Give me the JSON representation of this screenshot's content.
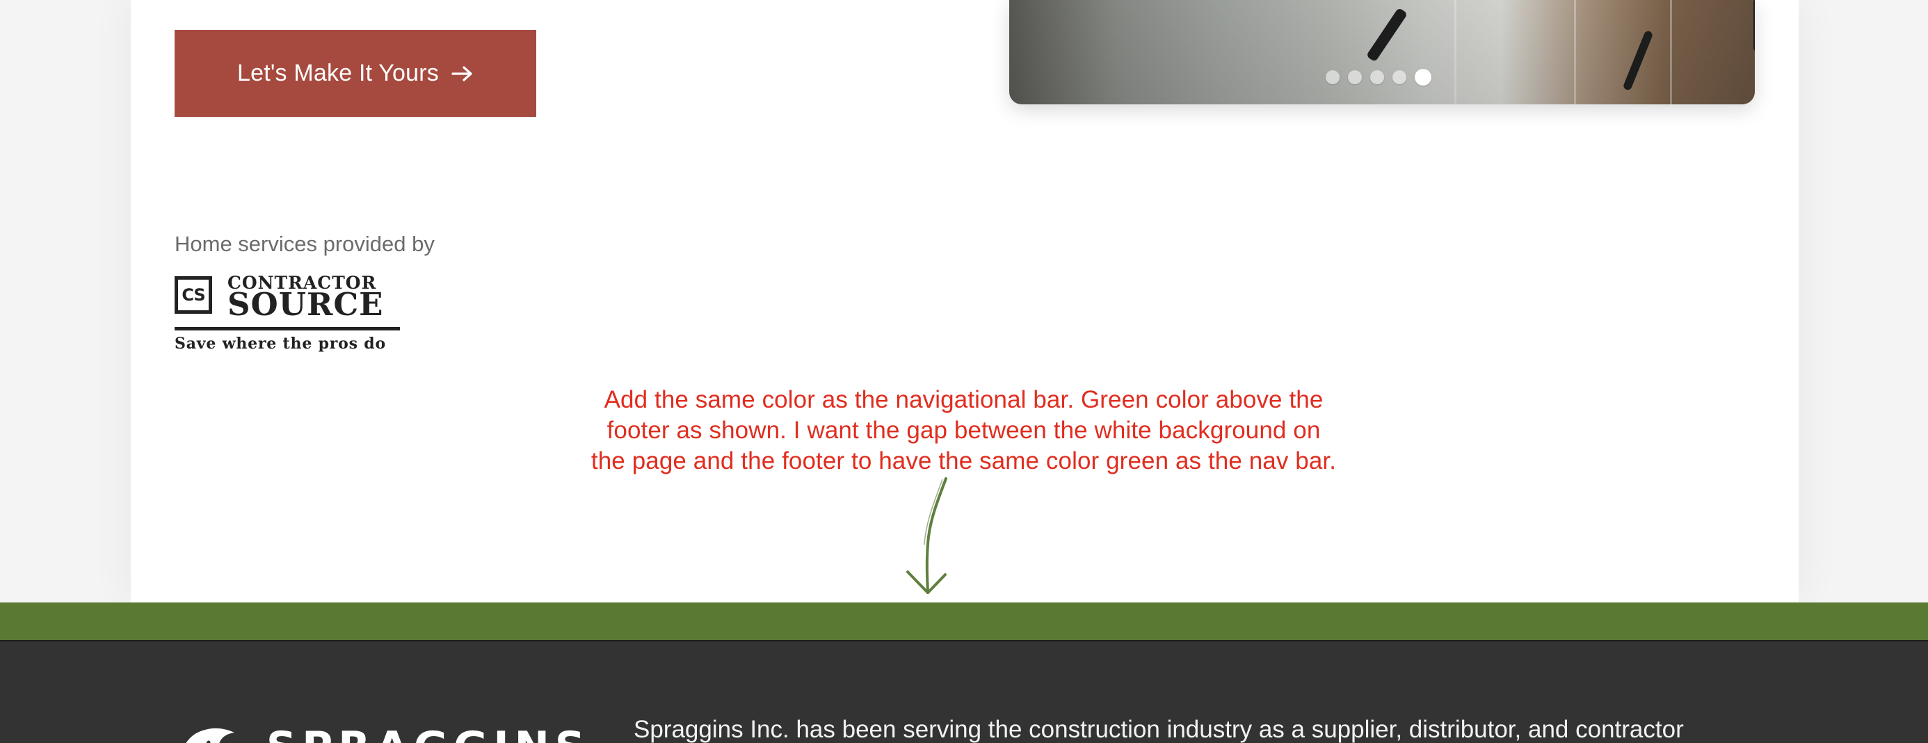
{
  "cta": {
    "label": "Let's Make It Yours",
    "icon": "arrow-right-icon",
    "color": "#a64a3f"
  },
  "carousel": {
    "slide_count": 5,
    "active_index": 4
  },
  "provider": {
    "label": "Home services provided by",
    "logo": {
      "mark": "CS",
      "line1": "CONTRACTOR",
      "line2": "SOURCE",
      "tagline": "Save where the pros do"
    }
  },
  "annotation": {
    "line1": "Add the same color as the navigational bar. Green color above the",
    "line2": "footer as shown. I want the gap between the white background on",
    "line3": "the page and the footer to have the same color green as the nav bar.",
    "color": "#e02d1f"
  },
  "colors": {
    "nav_green": "#5a7a33",
    "footer_bg": "#333333"
  },
  "footer": {
    "brand": "SPRAGGINS",
    "description": "Spraggins Inc. has been serving the construction industry as a supplier, distributor, and contractor"
  }
}
